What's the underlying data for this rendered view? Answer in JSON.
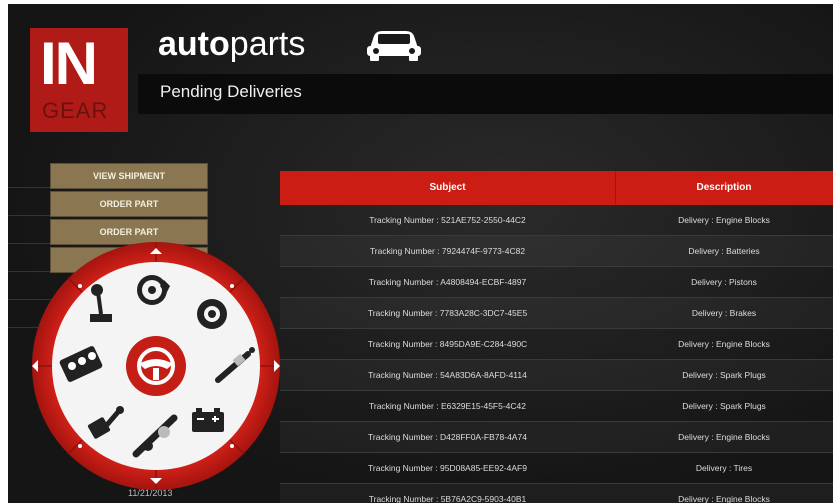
{
  "app": {
    "logo_in": "IN",
    "logo_gear": "GEAR",
    "brand_bold": "auto",
    "brand_light": "parts",
    "page_title": "Pending Deliveries",
    "accent": "#cc1d14"
  },
  "menu": {
    "items": [
      {
        "label": "VIEW SHIPMENT"
      },
      {
        "label": "ORDER PART"
      },
      {
        "label": "ORDER PART"
      }
    ]
  },
  "footer": {
    "date": "11/21/2013"
  },
  "grid": {
    "headers": {
      "subject": "Subject",
      "description": "Description"
    },
    "rows": [
      {
        "subject": "Tracking Number : 521AE752-2550-44C2",
        "description": "Delivery : Engine Blocks"
      },
      {
        "subject": "Tracking Number : 7924474F-9773-4C82",
        "description": "Delivery : Batteries"
      },
      {
        "subject": "Tracking Number : A4808494-ECBF-4897",
        "description": "Delivery : Pistons"
      },
      {
        "subject": "Tracking Number : 7783A28C-3DC7-45E5",
        "description": "Delivery : Brakes"
      },
      {
        "subject": "Tracking Number : 8495DA9E-C284-490C",
        "description": "Delivery : Engine Blocks"
      },
      {
        "subject": "Tracking Number : 54A83D6A-8AFD-4114",
        "description": "Delivery : Spark Plugs"
      },
      {
        "subject": "Tracking Number : E6329E15-45F5-4C42",
        "description": "Delivery : Spark Plugs"
      },
      {
        "subject": "Tracking Number : D428FF0A-FB78-4A74",
        "description": "Delivery : Engine Blocks"
      },
      {
        "subject": "Tracking Number : 95D08A85-EE92-4AF9",
        "description": "Delivery : Tires"
      },
      {
        "subject": "Tracking Number : 5B76A2C9-5903-40B1",
        "description": "Delivery : Engine Blocks"
      }
    ]
  },
  "radial_menu": {
    "center_icon": "steering-wheel-icon",
    "items": [
      "brake-disc-icon",
      "tire-icon",
      "spark-plug-icon",
      "battery-icon",
      "crankshaft-icon",
      "piston-icon",
      "engine-block-icon",
      "gear-shifter-icon"
    ]
  }
}
